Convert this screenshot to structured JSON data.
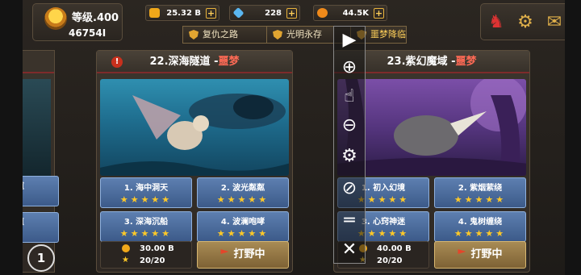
{
  "player": {
    "level_label": "等级.400",
    "power": "46754I"
  },
  "resources": [
    {
      "name": "gold",
      "value": "25.32 B",
      "color": "#f0a81a"
    },
    {
      "name": "gem",
      "value": "228",
      "color": "#5ab6f0"
    },
    {
      "name": "coin",
      "value": "44.5K",
      "color": "#f08a1a"
    }
  ],
  "tabs": [
    {
      "label": "复仇之路"
    },
    {
      "label": "光明永存"
    },
    {
      "label": "噩梦降临"
    }
  ],
  "left_card": {
    "sub1": "道",
    "sub2": "愿"
  },
  "stages": [
    {
      "title_prefix": "22.深海隧道 -",
      "title_hl": "噩梦",
      "scene": "sea",
      "subs": [
        {
          "name": "1. 海中洞天",
          "stars": "★★★★★"
        },
        {
          "name": "2. 波光粼粼",
          "stars": "★★★★★"
        },
        {
          "name": "3. 深海沉船",
          "stars": "★★★★★"
        },
        {
          "name": "4. 波澜咆哮",
          "stars": "★★★★★"
        }
      ],
      "reward_gold": "30.00 B",
      "reward_stars": "20/20",
      "action": "打野中"
    },
    {
      "title_prefix": "23.紫幻魔域 -",
      "title_hl": "噩梦",
      "scene": "forest",
      "subs": [
        {
          "name": "1. 初入幻境",
          "stars": "★★★★★"
        },
        {
          "name": "2. 紫烟萦绕",
          "stars": "★★★★★"
        },
        {
          "name": "3. 心窍神迷",
          "stars": "★★★★★"
        },
        {
          "name": "4. 鬼树缠绕",
          "stars": "★★★★★"
        }
      ],
      "reward_gold": "40.00 B",
      "reward_stars": "20/20",
      "action": "打野中"
    }
  ],
  "overlay": {
    "joystick_label": "1"
  },
  "colors": {
    "accent": "#ff6a55",
    "star": "#ffc928",
    "sub_bg": "#4a6c9e"
  }
}
